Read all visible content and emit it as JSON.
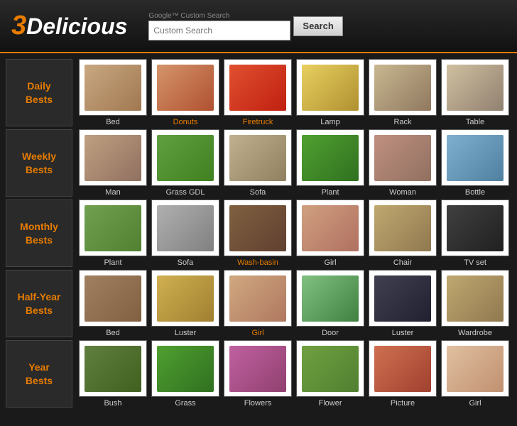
{
  "header": {
    "logo_3": "3",
    "logo_rest": "Delicious",
    "search_placeholder": "Custom Search",
    "search_google_label": "Google™ Custom Search",
    "search_button_label": "Search"
  },
  "sidebar": {
    "items": [
      {
        "id": "daily",
        "label": "Daily\nBests"
      },
      {
        "id": "weekly",
        "label": "Weekly\nBests"
      },
      {
        "id": "monthly",
        "label": "Monthly\nBests"
      },
      {
        "id": "halfyear",
        "label": "Half-Year\nBests"
      },
      {
        "id": "year",
        "label": "Year\nBests"
      }
    ]
  },
  "rows": [
    {
      "id": "daily",
      "items": [
        {
          "label": "Bed",
          "obj": "bed",
          "orange": false
        },
        {
          "label": "Donuts",
          "obj": "donuts",
          "orange": true
        },
        {
          "label": "Firetruck",
          "obj": "firetruck",
          "orange": true
        },
        {
          "label": "Lamp",
          "obj": "lamp",
          "orange": false
        },
        {
          "label": "Rack",
          "obj": "rack",
          "orange": false
        },
        {
          "label": "Table",
          "obj": "table",
          "orange": false
        }
      ]
    },
    {
      "id": "weekly",
      "items": [
        {
          "label": "Man",
          "obj": "man",
          "orange": false
        },
        {
          "label": "Grass GDL",
          "obj": "grass",
          "orange": false
        },
        {
          "label": "Sofa",
          "obj": "sofa",
          "orange": false
        },
        {
          "label": "Plant",
          "obj": "plant",
          "orange": false
        },
        {
          "label": "Woman",
          "obj": "woman",
          "orange": false
        },
        {
          "label": "Bottle",
          "obj": "bottle",
          "orange": false
        }
      ]
    },
    {
      "id": "monthly",
      "items": [
        {
          "label": "Plant",
          "obj": "plant2",
          "orange": false
        },
        {
          "label": "Sofa",
          "obj": "sofa2",
          "orange": false
        },
        {
          "label": "Wash-basin",
          "obj": "washbasin",
          "orange": true
        },
        {
          "label": "Girl",
          "obj": "girl",
          "orange": false
        },
        {
          "label": "Chair",
          "obj": "chair",
          "orange": false
        },
        {
          "label": "TV set",
          "obj": "tvset",
          "orange": false
        }
      ]
    },
    {
      "id": "halfyear",
      "items": [
        {
          "label": "Bed",
          "obj": "bed2",
          "orange": false
        },
        {
          "label": "Luster",
          "obj": "luster",
          "orange": false
        },
        {
          "label": "Girl",
          "obj": "girl2",
          "orange": true
        },
        {
          "label": "Door",
          "obj": "door",
          "orange": false
        },
        {
          "label": "Luster",
          "obj": "luster2",
          "orange": false
        },
        {
          "label": "Wardrobe",
          "obj": "wardrobe",
          "orange": false
        }
      ]
    },
    {
      "id": "year",
      "items": [
        {
          "label": "Bush",
          "obj": "bush",
          "orange": false
        },
        {
          "label": "Grass",
          "obj": "grass2",
          "orange": false
        },
        {
          "label": "Flowers",
          "obj": "flowers",
          "orange": false
        },
        {
          "label": "Flower",
          "obj": "flower",
          "orange": false
        },
        {
          "label": "Picture",
          "obj": "picture",
          "orange": false
        },
        {
          "label": "Girl",
          "obj": "girl3",
          "orange": false
        }
      ]
    }
  ]
}
